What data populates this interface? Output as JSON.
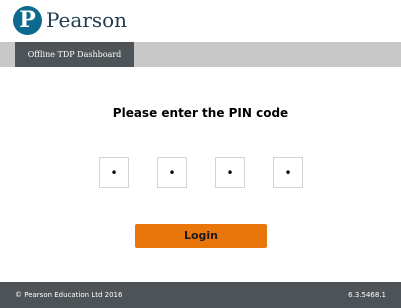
{
  "header": {
    "logo_letter": "P",
    "brand": "Pearson"
  },
  "nav": {
    "tab_label": "Offline TDP Dashboard"
  },
  "main": {
    "prompt": "Please enter the PIN code",
    "pin_values": [
      "•",
      "•",
      "•",
      "•"
    ],
    "login_label": "Login"
  },
  "footer": {
    "copyright": "© Pearson Education Ltd 2016",
    "version": "6.3.5468.1"
  },
  "colors": {
    "brand_blue": "#0c6a8f",
    "nav_bar": "#c8c8c8",
    "nav_tab": "#4d5357",
    "login_button": "#e8760b",
    "footer": "#4d5357"
  },
  "icons": {
    "logo": "pearson-logo-icon"
  }
}
